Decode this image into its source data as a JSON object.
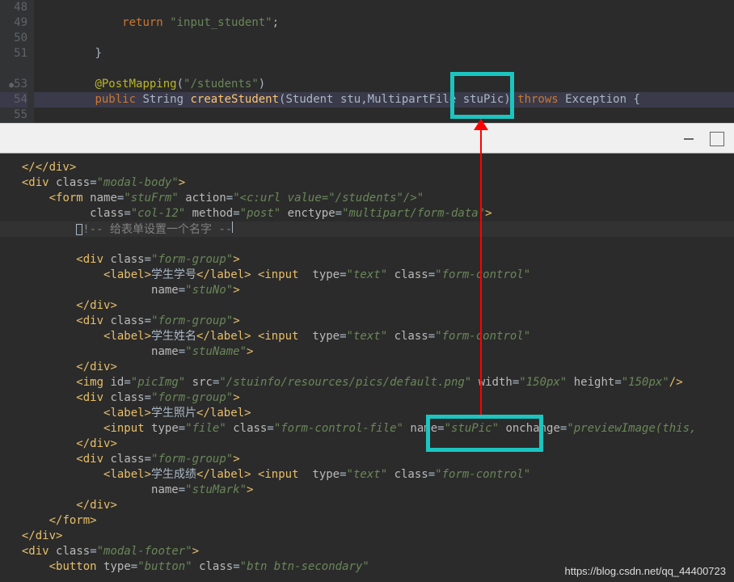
{
  "top_editor": {
    "lines": {
      "48": "48",
      "49": "49",
      "50": "50",
      "51": "51",
      "52": "",
      "53": "53",
      "54": "54",
      "55": "55"
    },
    "code": {
      "l49_return": "return",
      "l49_str": "\"input_student\"",
      "l49_semi": ";",
      "l51_brace": "}",
      "l53_annotation": "@PostMapping",
      "l53_paren_open": "(",
      "l53_str": "\"/students\"",
      "l53_paren_close": ")",
      "l54_public": "public",
      "l54_string": "String",
      "l54_method": "createStudent",
      "l54_paren": "(",
      "l54_student": "Student",
      "l54_stu": "stu",
      "l54_comma": ",",
      "l54_multipart": "MultipartFile",
      "l54_stupic": "stuPic",
      "l54_paren2": ")",
      "l54_throws": "throws",
      "l54_exception": "Exception",
      "l54_brace": "{"
    }
  },
  "bottom_editor": {
    "l1_close": "</div>",
    "l2_div": "div",
    "l2_class": "class",
    "l2_val": "\"modal-body\"",
    "l3_form": "form",
    "l3_name_attr": "name",
    "l3_name_val": "\"stuFrm\"",
    "l3_action": "action",
    "l3_action_val": "\"<c:url value=\"/students\"/>\"",
    "l4_class": "class",
    "l4_class_val": "\"col-12\"",
    "l4_method": "method",
    "l4_method_val": "\"post\"",
    "l4_enctype": "enctype",
    "l4_enctype_val": "\"multipart/form-data\"",
    "l5_comment": "!-- 给表单设置一个名字 --",
    "l7_div": "div",
    "l7_class": "class",
    "l7_val": "\"form-group\"",
    "l8_label": "label",
    "l8_text": "学生学号",
    "l8_input": "input",
    "l8_type": "type",
    "l8_type_val": "\"text\"",
    "l8_class": "class",
    "l8_class_val": "\"form-control\"",
    "l9_name": "name",
    "l9_val": "\"stuNo\"",
    "l10_close": "div",
    "l11_div": "div",
    "l11_val": "\"form-group\"",
    "l12_text": "学生姓名",
    "l12_class_val": "\"form-control\"",
    "l13_val": "\"stuName\"",
    "l15_img": "img",
    "l15_id": "id",
    "l15_id_val": "\"picImg\"",
    "l15_src": "src",
    "l15_src_val": "\"/stuinfo/resources/pics/default.png\"",
    "l15_width": "width",
    "l15_width_val": "\"150px\"",
    "l15_height": "height",
    "l15_height_val": "\"150px\"",
    "l16_val": "\"form-group\"",
    "l17_text": "学生照片",
    "l18_input": "input",
    "l18_type_val": "\"file\"",
    "l18_class_val": "\"form-control-file\"",
    "l18_name_val": "\"stuPic\"",
    "l18_onchange": "onchange",
    "l18_onchange_val": "\"previewImage(this,",
    "l20_val": "\"form-group\"",
    "l21_text": "学生成绩",
    "l21_class_val": "\"form-control\"",
    "l22_val": "\"stuMark\"",
    "l26_close": "div",
    "l27_div": "div",
    "l27_val": "\"modal-footer\"",
    "l28_button": "button",
    "l28_type_val": "\"button\"",
    "l28_class_val": "\"btn btn-secondary\""
  },
  "watermark": "https://blog.csdn.net/qq_44400723"
}
